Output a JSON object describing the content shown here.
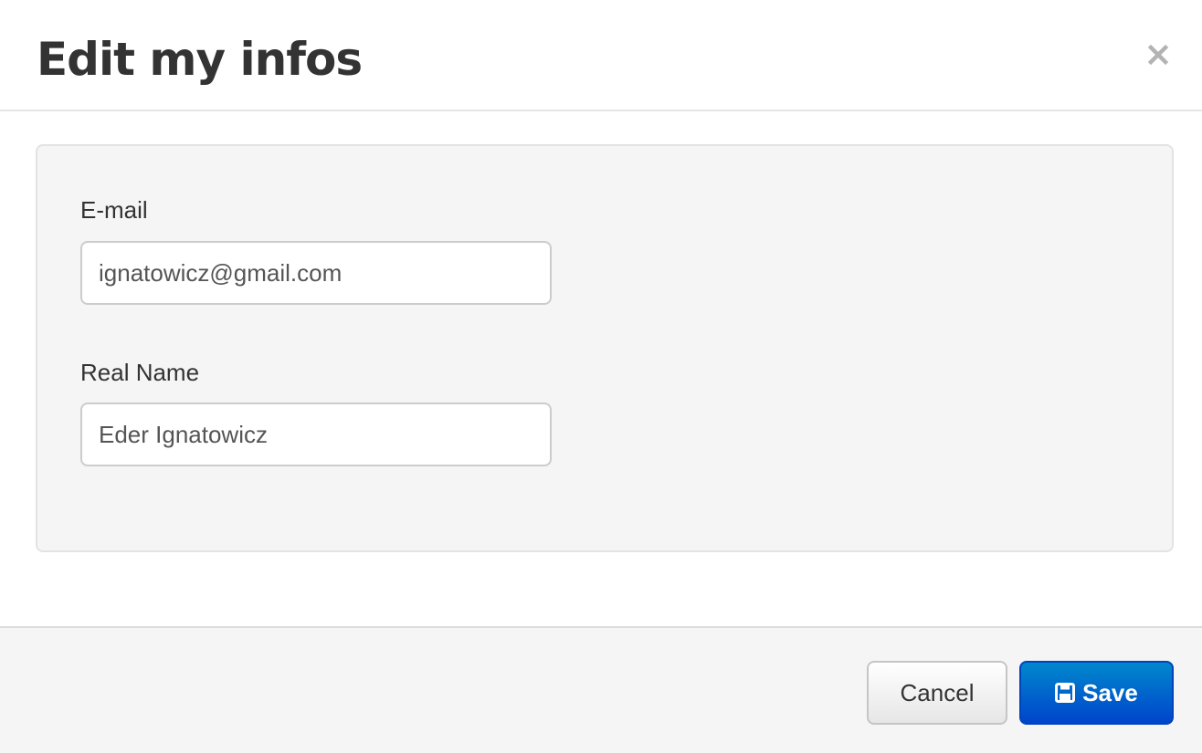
{
  "modal": {
    "title": "Edit my infos",
    "close_icon": "close-icon"
  },
  "form": {
    "email": {
      "label": "E-mail",
      "value": "ignatowicz@gmail.com"
    },
    "real_name": {
      "label": "Real Name",
      "value": "Eder Ignatowicz"
    }
  },
  "footer": {
    "cancel_label": "Cancel",
    "save_label": "Save",
    "save_icon": "floppy-disk-icon"
  },
  "colors": {
    "primary": "#0055cc",
    "well_background": "#f5f5f5"
  }
}
